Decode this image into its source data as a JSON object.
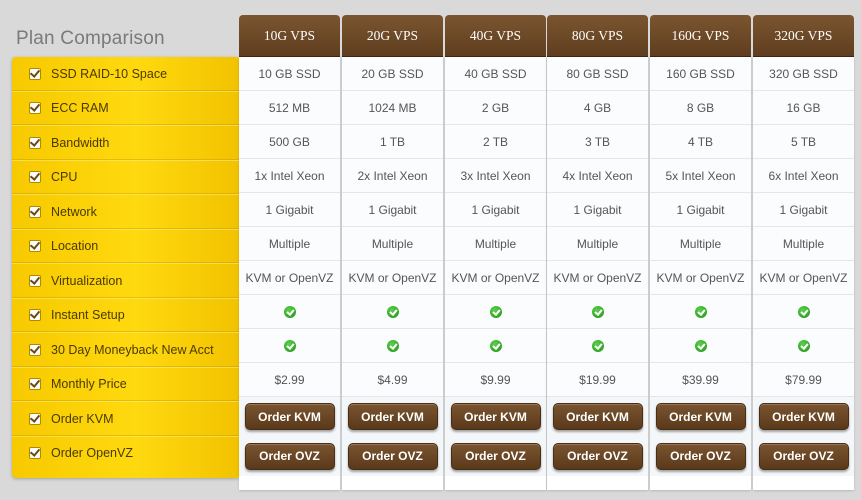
{
  "title": "Plan Comparison",
  "features": [
    "SSD RAID-10 Space",
    "ECC RAM",
    "Bandwidth",
    "CPU",
    "Network",
    "Location",
    "Virtualization",
    "Instant Setup",
    "30 Day Moneyback New Acct",
    "Monthly Price",
    "Order KVM",
    "Order OpenVZ"
  ],
  "plans": [
    {
      "name": "10G VPS",
      "ssd": "10 GB SSD",
      "ram": "512 MB",
      "bandwidth": "500 GB",
      "cpu": "1x Intel Xeon",
      "network": "1 Gigabit",
      "location": "Multiple",
      "virt": "KVM or OpenVZ",
      "price": "$2.99",
      "kvm": "Order KVM",
      "ovz": "Order OVZ"
    },
    {
      "name": "20G VPS",
      "ssd": "20 GB SSD",
      "ram": "1024 MB",
      "bandwidth": "1 TB",
      "cpu": "2x Intel Xeon",
      "network": "1 Gigabit",
      "location": "Multiple",
      "virt": "KVM or OpenVZ",
      "price": "$4.99",
      "kvm": "Order KVM",
      "ovz": "Order OVZ"
    },
    {
      "name": "40G VPS",
      "ssd": "40 GB SSD",
      "ram": "2 GB",
      "bandwidth": "2 TB",
      "cpu": "3x Intel Xeon",
      "network": "1 Gigabit",
      "location": "Multiple",
      "virt": "KVM or OpenVZ",
      "price": "$9.99",
      "kvm": "Order KVM",
      "ovz": "Order OVZ"
    },
    {
      "name": "80G VPS",
      "ssd": "80 GB SSD",
      "ram": "4 GB",
      "bandwidth": "3 TB",
      "cpu": "4x Intel Xeon",
      "network": "1 Gigabit",
      "location": "Multiple",
      "virt": "KVM or OpenVZ",
      "price": "$19.99",
      "kvm": "Order KVM",
      "ovz": "Order OVZ"
    },
    {
      "name": "160G VPS",
      "ssd": "160 GB SSD",
      "ram": "8 GB",
      "bandwidth": "4 TB",
      "cpu": "5x Intel Xeon",
      "network": "1 Gigabit",
      "location": "Multiple",
      "virt": "KVM or OpenVZ",
      "price": "$39.99",
      "kvm": "Order KVM",
      "ovz": "Order OVZ"
    },
    {
      "name": "320G VPS",
      "ssd": "320 GB SSD",
      "ram": "16 GB",
      "bandwidth": "5 TB",
      "cpu": "6x Intel Xeon",
      "network": "1 Gigabit",
      "location": "Multiple",
      "virt": "KVM or OpenVZ",
      "price": "$79.99",
      "kvm": "Order KVM",
      "ovz": "Order OVZ"
    }
  ],
  "icons": {
    "checkbox": "checkbox-icon",
    "included": "green-check-icon"
  },
  "colors": {
    "accent": "#ffd200",
    "header": "#6b4726",
    "check": "#2a9a1c"
  }
}
